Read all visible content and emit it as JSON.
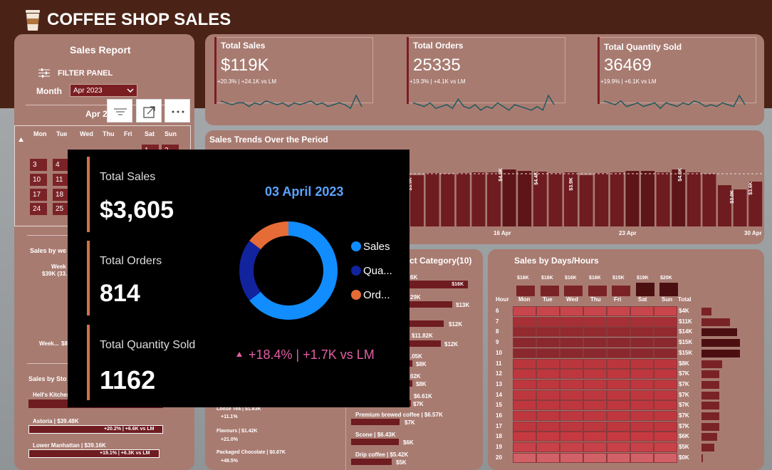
{
  "header": {
    "title": "COFFEE SHOP SALES",
    "icon": "coffee-cup-icon"
  },
  "sidebar": {
    "title": "Sales Report",
    "filter_label": "FILTER PANEL",
    "month_label": "Month",
    "month_value": "Apr 2023",
    "calendar_title": "Apr 2",
    "weekdays": [
      "Mon",
      "Tue",
      "Wed",
      "Thu",
      "Fri",
      "Sat",
      "Sun"
    ],
    "days": [
      "1",
      "2",
      "3",
      "4",
      "10",
      "11",
      "17",
      "18",
      "24",
      "25"
    ],
    "weekend_title": "Sales by we",
    "weekday_label": "Week",
    "weekday_value": "$39K (33.",
    "weekend_label": "Week...",
    "weekend_value": "$8",
    "store_title": "Sales by Sto",
    "stores": [
      {
        "label": "Hell's Kitchen",
        "delta": ""
      },
      {
        "label": "Astoria | $39.48K",
        "delta": "+20.2% | +6.6K vs LM"
      },
      {
        "label": "Lower Manhattan | $39.16K",
        "delta": "+19.1% | +6.3K vs LM"
      }
    ]
  },
  "kpis": [
    {
      "title": "Total Sales",
      "value": "$119K",
      "delta": "+20.3% | +24.1K vs LM",
      "spark": [
        7,
        6,
        5,
        6,
        6,
        4,
        6,
        5,
        7,
        6,
        5,
        6,
        4,
        6,
        5,
        6,
        7,
        5,
        6,
        4,
        5,
        6,
        5,
        3,
        10,
        4
      ]
    },
    {
      "title": "Total Orders",
      "value": "25335",
      "delta": "+19.3% | +4.1K vs LM",
      "spark": [
        6,
        5,
        4,
        6,
        3,
        4,
        5,
        3,
        8,
        4,
        3,
        5,
        2,
        4,
        3,
        6,
        4,
        2,
        5,
        4,
        3,
        2,
        4,
        2,
        10,
        5
      ]
    },
    {
      "title": "Total Quantity Sold",
      "value": "36469",
      "delta": "+19.9% | +6.1K vs LM",
      "spark": [
        7,
        6,
        5,
        7,
        4,
        5,
        6,
        4,
        5,
        6,
        3,
        6,
        5,
        4,
        6,
        5,
        7,
        6,
        4,
        5,
        4,
        6,
        5,
        4,
        10,
        5
      ]
    }
  ],
  "trend": {
    "title": "Sales Trends Over the Period",
    "bar_labels": [
      "$3.9K",
      "$4.5K",
      "$4.4K",
      "$3.9K",
      "$4.6K",
      "$3.0K",
      "$3.6K"
    ],
    "axis_labels": [
      "16 Apr",
      "23 Apr",
      "30 Apr"
    ]
  },
  "category": {
    "title": "ct Category(10)",
    "labels": [
      "6K",
      "$16K",
      "29K",
      "$13K",
      "$12K",
      "$11.82K",
      "$12K",
      ".05K",
      "$8K",
      "02K",
      "$8K",
      "$6.61K",
      "$7K"
    ],
    "sub_items": [
      {
        "label": "Premium brewed coffee | $6.57K",
        "value": "$7K"
      },
      {
        "label": "Scone | $6.43K",
        "value": "$6K"
      },
      {
        "label": "Drip coffee | $5.42K",
        "value": "$5K"
      }
    ],
    "left_items": [
      {
        "label": "Loose Tea | $1.83K",
        "delta": "+11.1%"
      },
      {
        "label": "Flavours | $1.42K",
        "delta": "+21.0%"
      },
      {
        "label": "Packaged Chocolate | $0.87K",
        "delta": "+48.5%"
      }
    ]
  },
  "days_hours": {
    "title": "Sales by Days/Hours",
    "day_totals": [
      "$16K",
      "$16K",
      "$16K",
      "$16K",
      "$15K",
      "$19K",
      "$20K"
    ],
    "days": [
      "Mon",
      "Tue",
      "Wed",
      "Thu",
      "Fri",
      "Sat",
      "Sun"
    ],
    "hour_header": "Hour",
    "total_header": "Total",
    "hours": [
      "6",
      "7",
      "8",
      "9",
      "10",
      "11",
      "12",
      "13",
      "14",
      "15",
      "16",
      "17",
      "18",
      "19",
      "20"
    ],
    "hour_totals": [
      "$4K",
      "$11K",
      "$14K",
      "$15K",
      "$15K",
      "$8K",
      "$7K",
      "$7K",
      "$7K",
      "$7K",
      "$7K",
      "$7K",
      "$6K",
      "$5K",
      "$0K"
    ],
    "hour_values": [
      4,
      11,
      14,
      15,
      15,
      8,
      7,
      7,
      7,
      7,
      7,
      7,
      6,
      5,
      0.3
    ]
  },
  "tooltip": {
    "sales_label": "Total Sales",
    "sales_value": "$3,605",
    "orders_label": "Total Orders",
    "orders_value": "814",
    "qty_label": "Total Quantity Sold",
    "qty_value": "1162",
    "date": "03 April 2023",
    "legend": [
      "Sales",
      "Qua...",
      "Ord..."
    ],
    "delta": "+18.4% | +1.7K vs LM",
    "donut": [
      {
        "name": "Sales",
        "value": 3605,
        "color": "#118dff"
      },
      {
        "name": "Quantity",
        "value": 1162,
        "color": "#12239e"
      },
      {
        "name": "Orders",
        "value": 814,
        "color": "#e66c37"
      }
    ]
  },
  "colors": {
    "accent": "#7a1e22",
    "card": "#a87b71",
    "header": "#4a2316",
    "spark": "#1f5a5f",
    "delta_pink": "#e55fa7"
  }
}
